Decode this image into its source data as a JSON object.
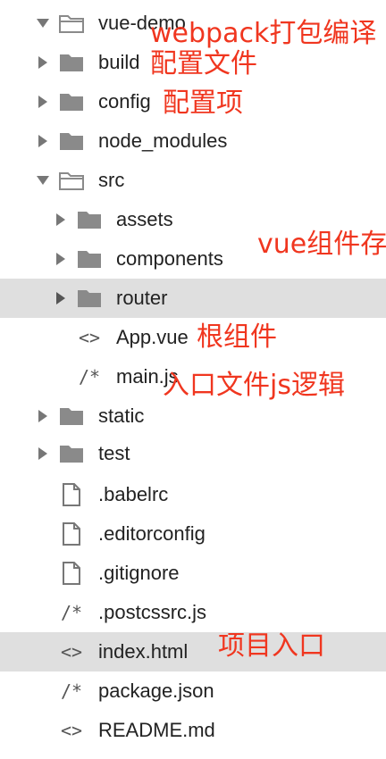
{
  "tree": {
    "items": [
      {
        "label": "vue-demo",
        "icon": "folder-open-icon",
        "expanded": true
      },
      {
        "label": "build",
        "icon": "folder-icon",
        "expanded": false
      },
      {
        "label": "config",
        "icon": "folder-icon",
        "expanded": false
      },
      {
        "label": "node_modules",
        "icon": "folder-icon",
        "expanded": false
      },
      {
        "label": "src",
        "icon": "folder-open-icon",
        "expanded": true
      },
      {
        "label": "assets",
        "icon": "folder-icon",
        "expanded": false
      },
      {
        "label": "components",
        "icon": "folder-icon",
        "expanded": false
      },
      {
        "label": "router",
        "icon": "folder-icon",
        "expanded": false,
        "selected": true
      },
      {
        "label": "App.vue",
        "icon": "code-icon"
      },
      {
        "label": "main.js",
        "icon": "comment-icon"
      },
      {
        "label": "static",
        "icon": "folder-icon",
        "expanded": false
      },
      {
        "label": "test",
        "icon": "folder-icon",
        "expanded": false
      },
      {
        "label": ".babelrc",
        "icon": "file-icon"
      },
      {
        "label": ".editorconfig",
        "icon": "file-icon"
      },
      {
        "label": ".gitignore",
        "icon": "file-icon"
      },
      {
        "label": ".postcssrc.js",
        "icon": "comment-icon"
      },
      {
        "label": "index.html",
        "icon": "code-icon",
        "selected": true
      },
      {
        "label": "package.json",
        "icon": "comment-icon"
      },
      {
        "label": "README.md",
        "icon": "code-icon"
      }
    ]
  },
  "annotations": {
    "webpack": "webpack打包编译",
    "build": "配置文件",
    "config": "配置项",
    "components": "vue组件存",
    "app": "根组件",
    "main": "入口文件js逻辑",
    "index": "项目入口"
  },
  "glyphs": {
    "code": "<>",
    "comment": "/*"
  },
  "colors": {
    "annotation": "#f0361f",
    "selection": "#dfdfdf",
    "folder": "#8a8a8a"
  }
}
